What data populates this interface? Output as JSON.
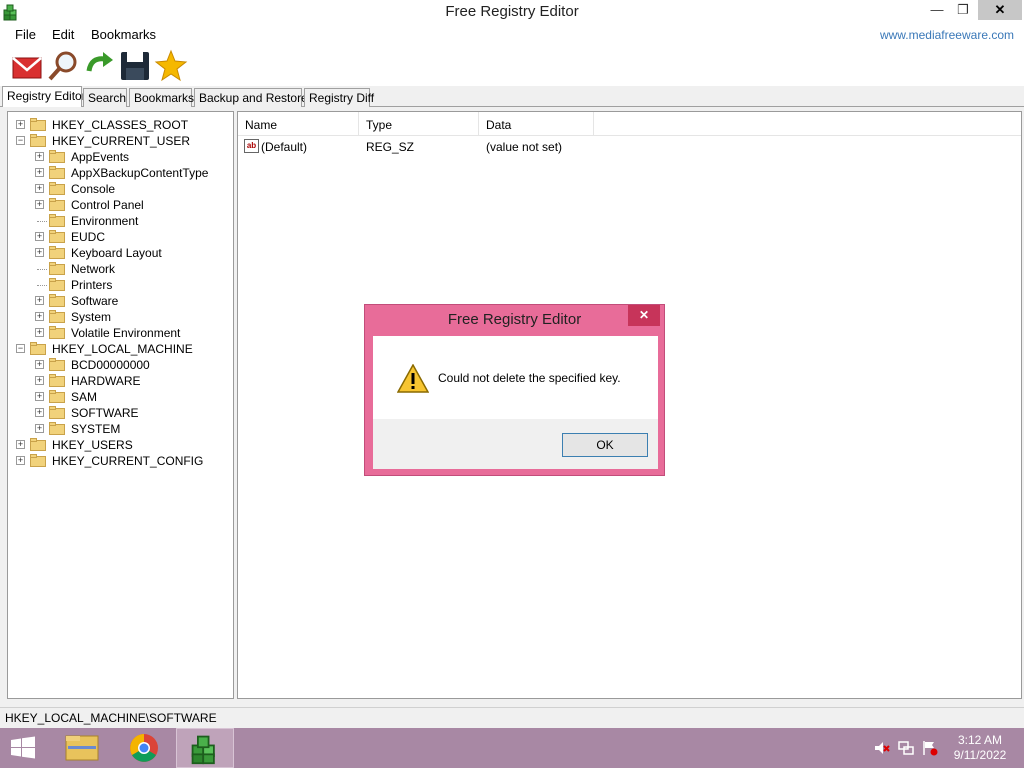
{
  "window": {
    "title": "Free Registry Editor",
    "controls": {
      "minimize": "—",
      "restore": "❐",
      "close": "✕"
    }
  },
  "menu": {
    "items": [
      "File",
      "Edit",
      "Bookmarks"
    ],
    "url": "www.mediafreeware.com"
  },
  "toolbar": {
    "buttons": [
      "envelope-icon",
      "magnifier-icon",
      "refresh-arrow-icon",
      "floppy-disk-icon",
      "star-icon"
    ]
  },
  "tabs": [
    "Registry Editor",
    "Search",
    "Bookmarks",
    "Backup and Restore",
    "Registry Diff"
  ],
  "active_tab": "Registry Editor",
  "tree": [
    {
      "label": "HKEY_CLASSES_ROOT",
      "level": 0,
      "expander": "+"
    },
    {
      "label": "HKEY_CURRENT_USER",
      "level": 0,
      "expander": "−"
    },
    {
      "label": "AppEvents",
      "level": 1,
      "expander": "+"
    },
    {
      "label": "AppXBackupContentType",
      "level": 1,
      "expander": "+"
    },
    {
      "label": "Console",
      "level": 1,
      "expander": "+"
    },
    {
      "label": "Control Panel",
      "level": 1,
      "expander": "+"
    },
    {
      "label": "Environment",
      "level": 1,
      "expander": ""
    },
    {
      "label": "EUDC",
      "level": 1,
      "expander": "+"
    },
    {
      "label": "Keyboard Layout",
      "level": 1,
      "expander": "+"
    },
    {
      "label": "Network",
      "level": 1,
      "expander": ""
    },
    {
      "label": "Printers",
      "level": 1,
      "expander": ""
    },
    {
      "label": "Software",
      "level": 1,
      "expander": "+"
    },
    {
      "label": "System",
      "level": 1,
      "expander": "+"
    },
    {
      "label": "Volatile Environment",
      "level": 1,
      "expander": "+"
    },
    {
      "label": "HKEY_LOCAL_MACHINE",
      "level": 0,
      "expander": "−"
    },
    {
      "label": "BCD00000000",
      "level": 1,
      "expander": "+"
    },
    {
      "label": "HARDWARE",
      "level": 1,
      "expander": "+"
    },
    {
      "label": "SAM",
      "level": 1,
      "expander": "+"
    },
    {
      "label": "SOFTWARE",
      "level": 1,
      "expander": "+",
      "selected": true
    },
    {
      "label": "SYSTEM",
      "level": 1,
      "expander": "+"
    },
    {
      "label": "HKEY_USERS",
      "level": 0,
      "expander": "+"
    },
    {
      "label": "HKEY_CURRENT_CONFIG",
      "level": 0,
      "expander": "+"
    }
  ],
  "values_table": {
    "headers": [
      "Name",
      "Type",
      "Data"
    ],
    "rows": [
      {
        "icon": "ab",
        "name": "(Default)",
        "type": "REG_SZ",
        "data": "(value not set)"
      }
    ]
  },
  "status": {
    "path": "HKEY_LOCAL_MACHINE\\SOFTWARE"
  },
  "dialog": {
    "title": "Free Registry Editor",
    "message": "Could not delete the specified key.",
    "ok_label": "OK",
    "close_label": "✕"
  },
  "taskbar": {
    "time": "3:12 AM",
    "date": "9/11/2022"
  },
  "colors": {
    "dialog_frame": "#e86c99",
    "dialog_close": "#c7345a",
    "taskbar": "#a888a4",
    "link": "#3a78b8"
  }
}
